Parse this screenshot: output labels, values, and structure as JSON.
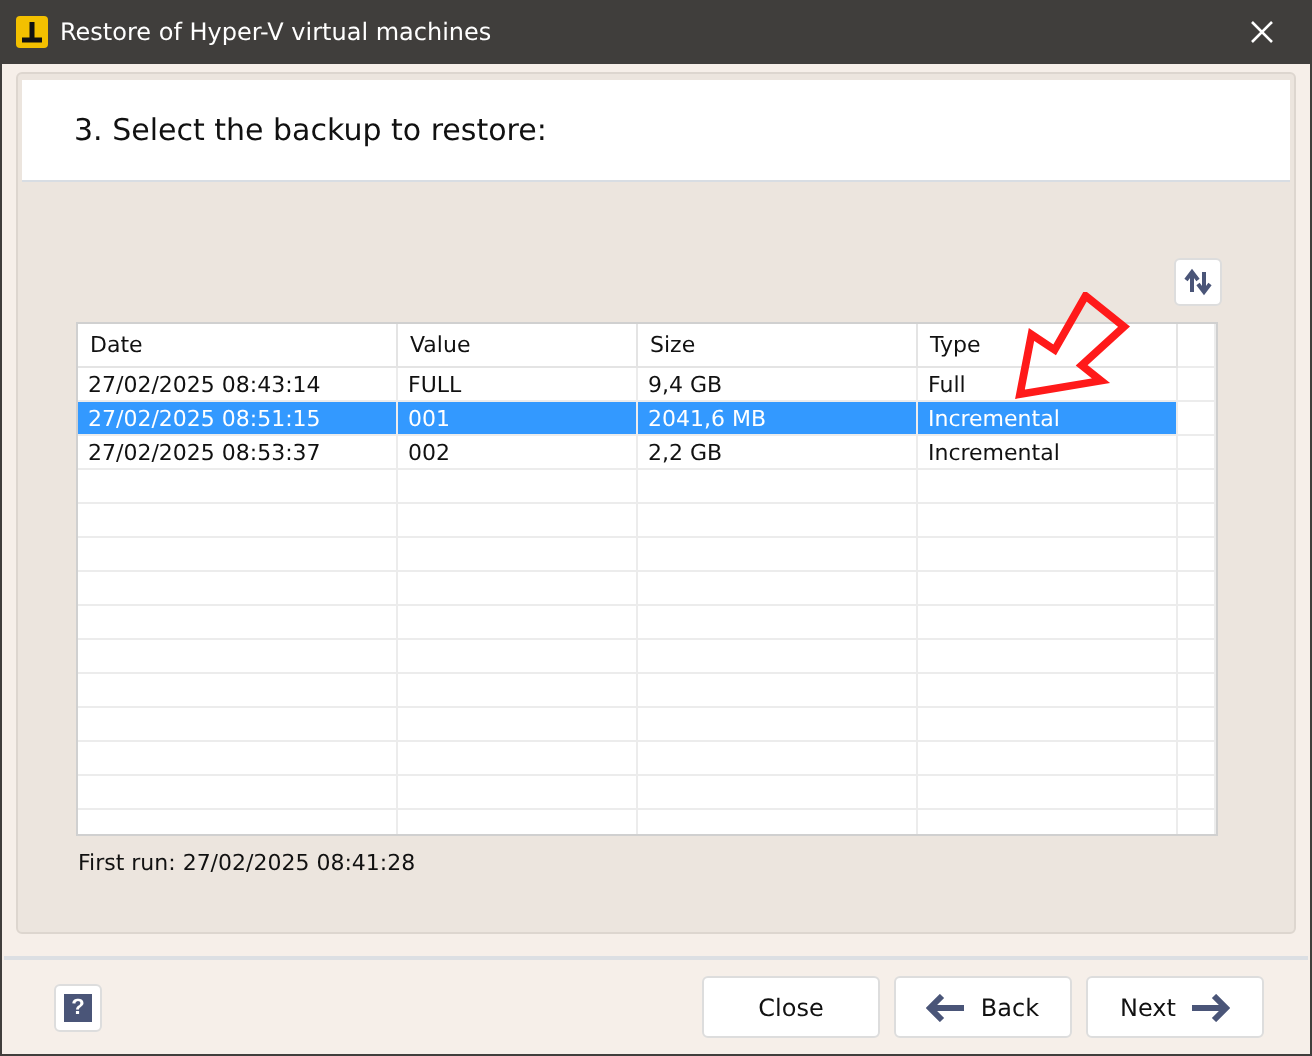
{
  "window": {
    "title": "Restore of Hyper-V virtual machines"
  },
  "step": {
    "title": "3. Select the backup to restore:"
  },
  "table": {
    "columns": [
      "Date",
      "Value",
      "Size",
      "Type"
    ],
    "rows": [
      {
        "cells": [
          "27/02/2025 08:43:14",
          "FULL",
          "9,4 GB",
          "Full"
        ],
        "selected": false
      },
      {
        "cells": [
          "27/02/2025 08:51:15",
          "001",
          "2041,6 MB",
          "Incremental"
        ],
        "selected": true
      },
      {
        "cells": [
          "27/02/2025 08:53:37",
          "002",
          "2,2 GB",
          "Incremental"
        ],
        "selected": false
      }
    ]
  },
  "first_run": "First run: 27/02/2025 08:41:28",
  "buttons": [
    {
      "label": "Close",
      "kind": "plain"
    },
    {
      "label": "Back",
      "kind": "back"
    },
    {
      "label": "Next",
      "kind": "next"
    }
  ],
  "help": {
    "label": "?"
  }
}
